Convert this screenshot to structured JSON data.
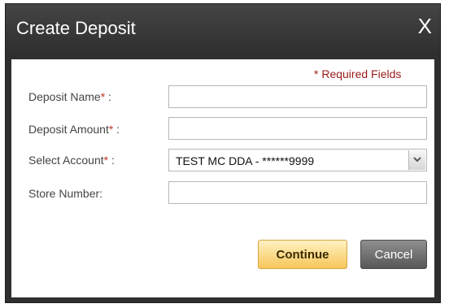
{
  "dialog": {
    "title": "Create Deposit",
    "close_label": "X"
  },
  "form": {
    "required_note": "* Required Fields",
    "deposit_name": {
      "label": "Deposit Name",
      "star": "*",
      "suffix": " :",
      "value": ""
    },
    "deposit_amount": {
      "label": "Deposit Amount",
      "star": "*",
      "suffix": " :",
      "value": ""
    },
    "select_account": {
      "label": "Select Account",
      "star": "*",
      "suffix": " :",
      "value": "TEST MC DDA - ******9999"
    },
    "store_number": {
      "label": "Store Number:",
      "value": ""
    }
  },
  "buttons": {
    "continue": "Continue",
    "cancel": "Cancel"
  },
  "colors": {
    "titlebar": "#3a3a3a",
    "required": "#9b1b1b",
    "continue_button": "#f7c75a",
    "cancel_button": "#6f6f6f"
  },
  "icons": {
    "close": "close-icon",
    "dropdown": "chevron-down-icon"
  }
}
